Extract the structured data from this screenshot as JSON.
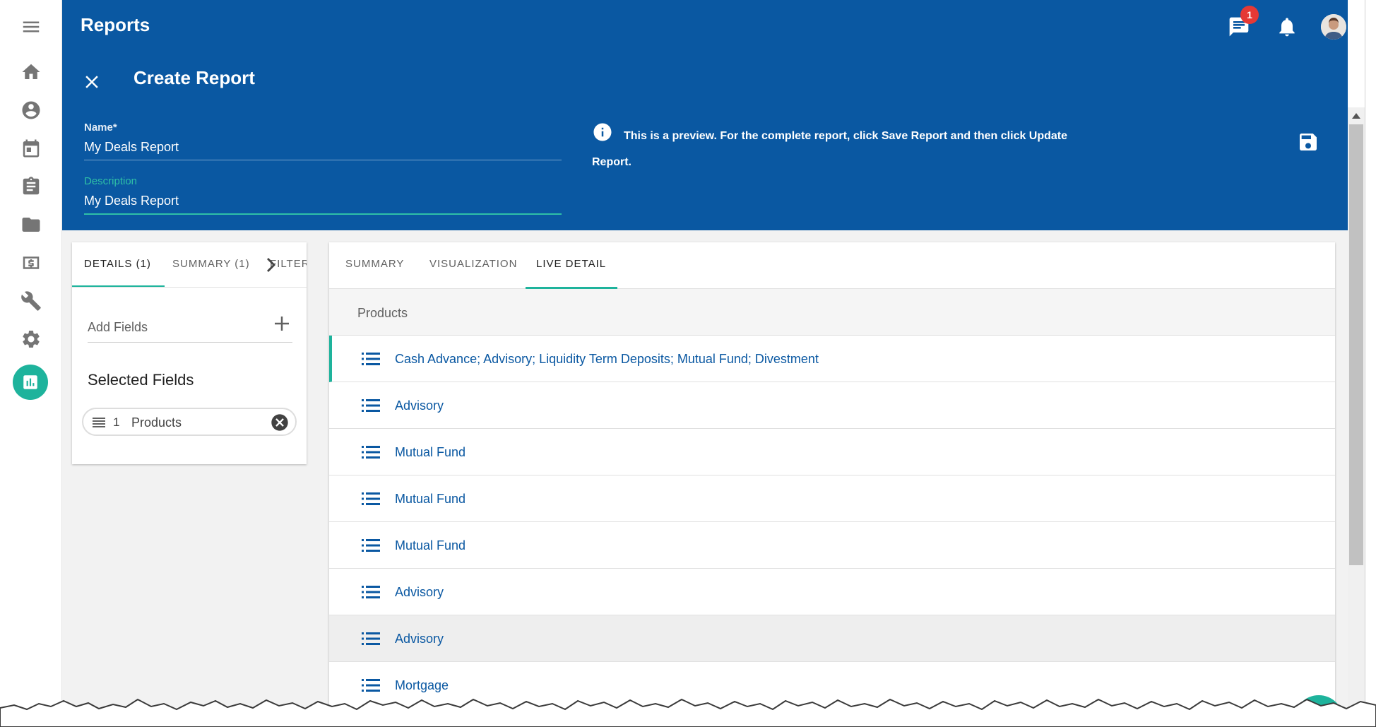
{
  "app": {
    "title": "Reports"
  },
  "header": {
    "notification_count": "1",
    "create_title": "Create Report",
    "name_label": "Name*",
    "name_value": "My Deals Report",
    "description_label": "Description",
    "description_value": "My Deals Report",
    "preview_notice": "This is a preview. For the complete report, click Save Report and then click Update Report."
  },
  "left_panel": {
    "tabs": [
      {
        "label": "DETAILS (1)"
      },
      {
        "label": "SUMMARY (1)"
      },
      {
        "label": "FILTER"
      }
    ],
    "add_fields_label": "Add Fields",
    "selected_fields_title": "Selected Fields",
    "selected_fields": [
      {
        "order": "1",
        "label": "Products"
      }
    ]
  },
  "right_panel": {
    "tabs": [
      {
        "label": "SUMMARY"
      },
      {
        "label": "VISUALIZATION"
      },
      {
        "label": "LIVE DETAIL"
      }
    ],
    "column_header": "Products",
    "rows": [
      "Cash Advance; Advisory; Liquidity Term Deposits; Mutual Fund; Divestment",
      "Advisory",
      "Mutual Fund",
      "Mutual Fund",
      "Mutual Fund",
      "Advisory",
      "Advisory",
      "Mortgage"
    ]
  },
  "colors": {
    "header_blue": "#0a58a2",
    "accent_teal": "#1eb39c",
    "badge_red": "#e53935",
    "link_blue": "#0a58a2"
  },
  "icons": {
    "rail": [
      "menu-icon",
      "home-icon",
      "account-icon",
      "calendar-icon",
      "clipboard-icon",
      "folder-icon",
      "money-icon",
      "wrench-icon",
      "gear-icon",
      "chart-icon"
    ],
    "header": [
      "chat-icon",
      "bell-icon",
      "avatar",
      "close-icon",
      "info-icon",
      "save-icon"
    ]
  }
}
